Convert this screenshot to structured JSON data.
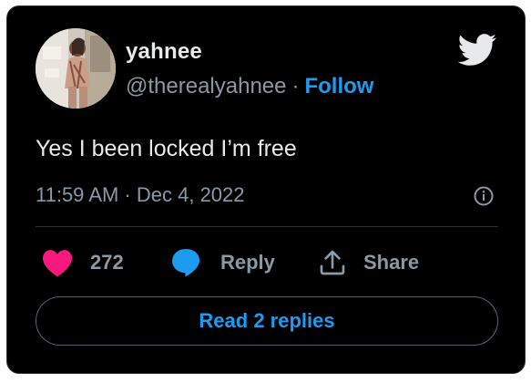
{
  "author": {
    "name": "yahnee",
    "handle": "@therealyahnee",
    "separator": "·",
    "follow_label": "Follow"
  },
  "tweet": {
    "text": "Yes I been locked I’m free",
    "timestamp": "11:59 AM · Dec 4, 2022"
  },
  "actions": {
    "like_count": "272",
    "reply_label": "Reply",
    "share_label": "Share"
  },
  "footer": {
    "read_replies_label": "Read 2 replies"
  },
  "icons": {
    "brand": "twitter-bird-icon",
    "info": "info-icon",
    "like": "heart-icon",
    "reply": "speech-bubble-icon",
    "share": "share-upload-icon"
  },
  "colors": {
    "background": "#000000",
    "text_primary": "#e7e9ea",
    "text_secondary": "#8b98a5",
    "accent_blue": "#1d9bf0",
    "like_pink": "#f91880",
    "border": "#2f3336"
  }
}
